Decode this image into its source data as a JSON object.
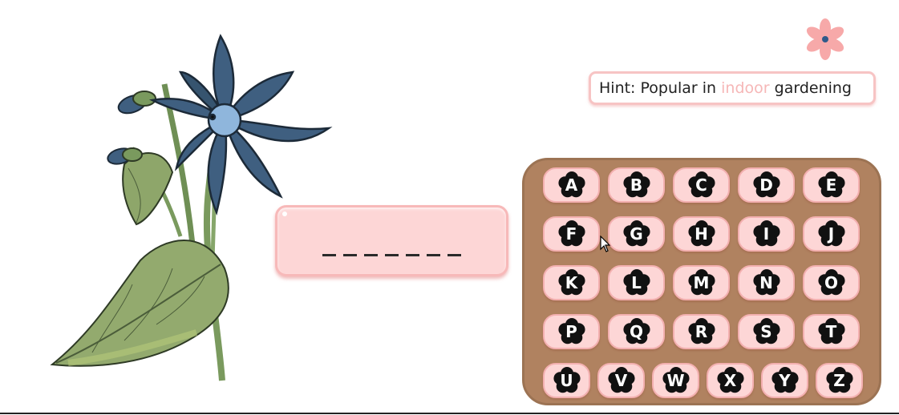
{
  "hint": {
    "prefix": "Hint: Popular in ",
    "highlight": "indoor",
    "suffix": " gardening"
  },
  "word": {
    "slots": [
      "_",
      "_",
      "_",
      "_",
      "_",
      "_",
      "_"
    ]
  },
  "keyboard": {
    "rows": [
      [
        "A",
        "B",
        "C",
        "D",
        "E"
      ],
      [
        "F",
        "G",
        "H",
        "I",
        "J"
      ],
      [
        "K",
        "L",
        "M",
        "N",
        "O"
      ],
      [
        "P",
        "Q",
        "R",
        "S",
        "T"
      ],
      [
        "U",
        "V",
        "W",
        "X",
        "Y",
        "Z"
      ]
    ]
  },
  "colors": {
    "accent_pink": "#fdd6d6",
    "pink_border": "#f7b9b9",
    "keyboard_brown": "#b08260",
    "flower_blue": "#3f5f80"
  },
  "icons": {
    "logo": "pink-flower-icon",
    "illustration": "blue-flower-illustration",
    "cursor": "mouse-pointer-icon"
  }
}
